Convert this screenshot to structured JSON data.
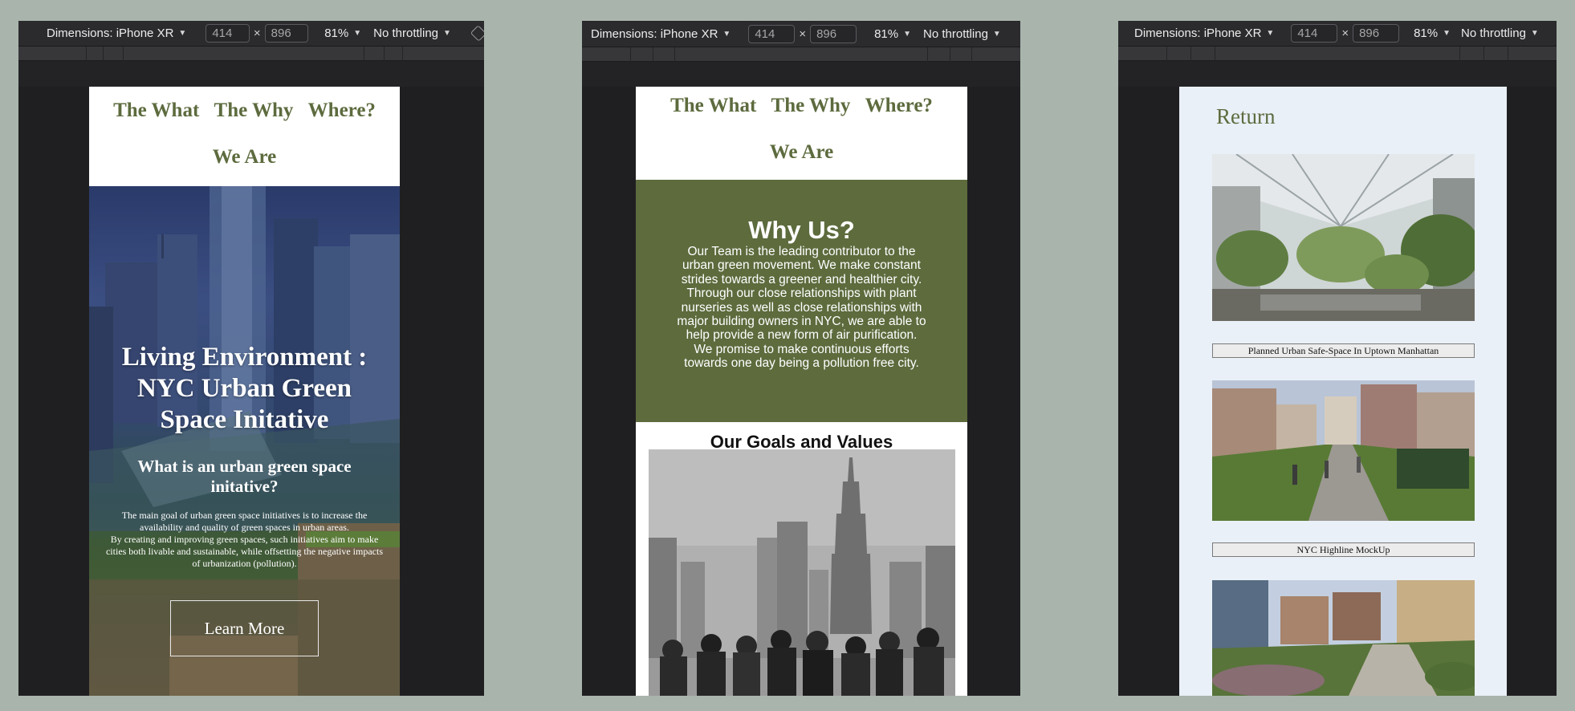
{
  "devtools": {
    "dimensions_label": "Dimensions: iPhone XR",
    "width_value": "414",
    "height_value": "896",
    "times": "×",
    "zoom": "81%",
    "throttle": "No throttling"
  },
  "nav": {
    "what": "The What",
    "why": "The Why",
    "where": "Where?",
    "we_are": "We Are"
  },
  "home": {
    "title": "Living Environment : NYC Urban Green Space Initative",
    "subtitle": "What is an urban green space initative?",
    "body_1": "The main goal of urban green space initiatives is to increase the availability and quality of green spaces in urban areas.",
    "body_2": "By creating and improving green spaces, such initiatives aim to make cities both livable and sustainable, while offsetting the negative impacts of urbanization (pollution).",
    "button": "Learn More"
  },
  "why": {
    "heading": "Why Us?",
    "body": "Our Team is the leading contributor to the urban green movement. We make constant strides towards a greener and healthier city. Through our close relationships with plant nurseries as well as close relationships with major building owners in NYC, we are able to help provide a new form of air purification. We promise to make continuous efforts towards one day being a pollution free city.",
    "goals_heading": "Our Goals and Values"
  },
  "where": {
    "return": "Return",
    "caption_1": "Planned Urban Safe-Space In Uptown Manhattan",
    "caption_2": "NYC Highline MockUp"
  },
  "colors": {
    "page_bg": "#a9b5ac",
    "brand_green": "#5d6b3d",
    "devtools_bg": "#2b2b2e"
  }
}
